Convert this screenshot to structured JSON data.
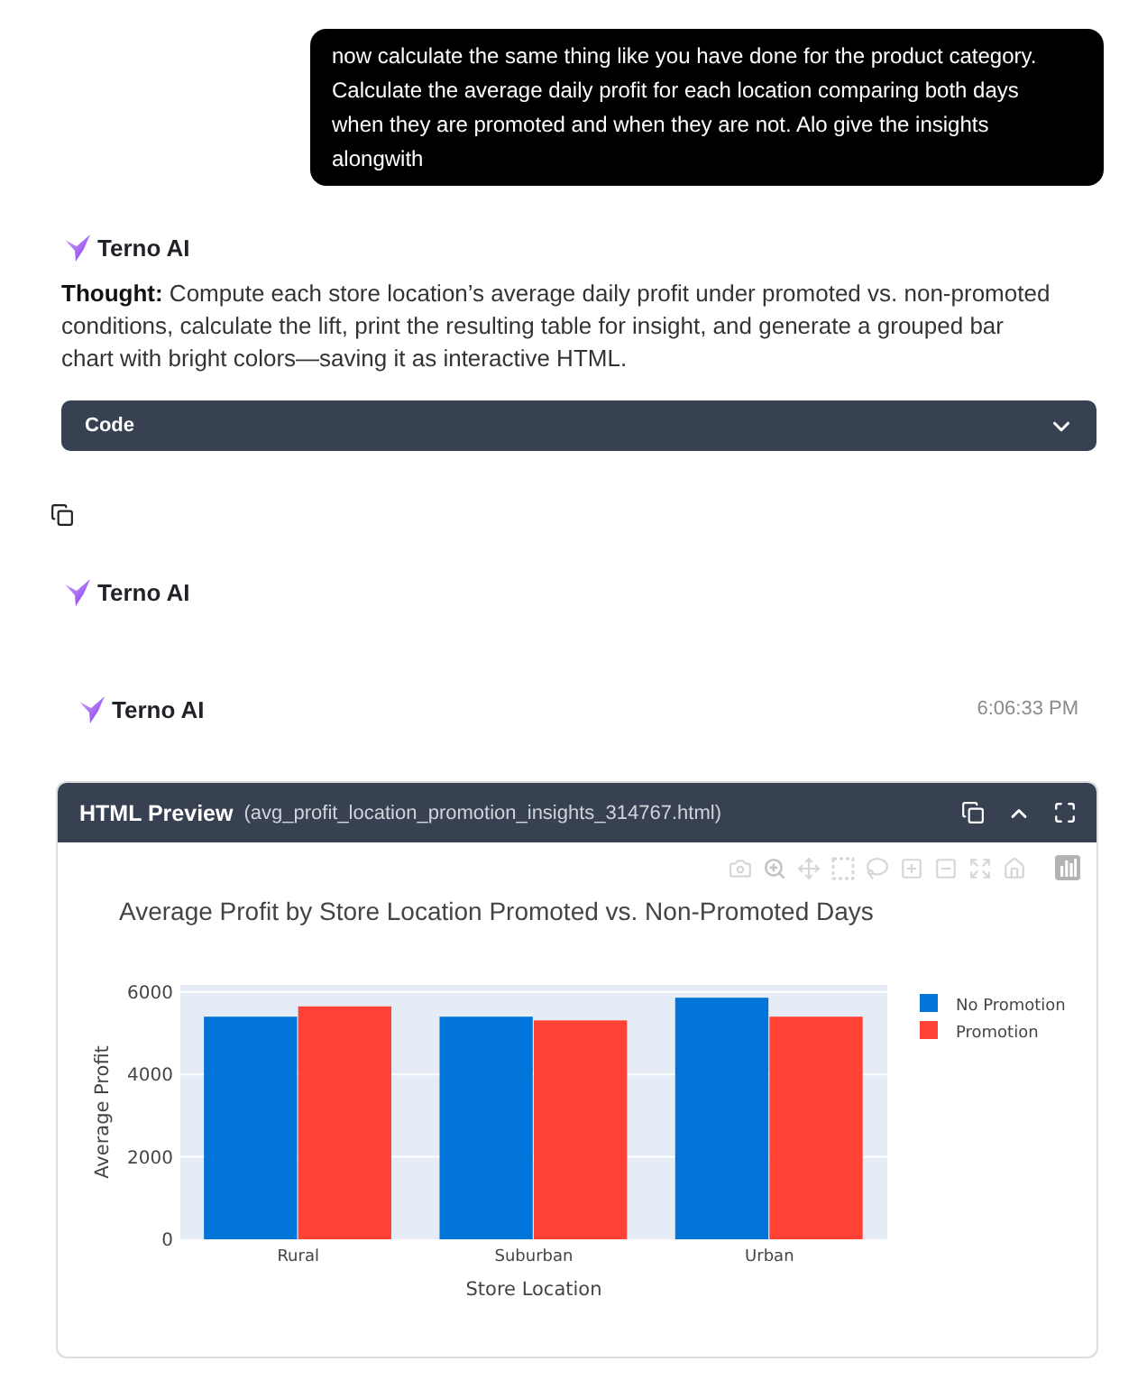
{
  "user_message": {
    "text": "now calculate the same thing like you have done for the product category. Calculate the average daily profit for each location comparing both days when they are promoted and when they are not. Alo give the insights alongwith"
  },
  "reply": {
    "author": "Terno AI",
    "thought": "**Thought:** Compute each store location’s average daily profit under promoted vs. non-promoted conditions, calculate the lift, print the resulting table for insight, and generate a grouped bar chart with bright colors—saving it as interactive HTML.",
    "code_section": {
      "label": "Code",
      "expanded": false
    }
  },
  "reply_2": {
    "author": "Terno AI"
  },
  "reply_3": {
    "author": "Terno AI",
    "time": "6:06:33 PM",
    "html_preview": {
      "title": "HTML Preview",
      "filename": "(avg_profit_location_promotion_insights_314767.html)",
      "expanded": true,
      "chart_data": {
        "type": "bar",
        "title": "Average Profit by Store Location Promoted vs. Non-Promoted Days",
        "xlabel": "Store Location",
        "ylabel": "Average Profit",
        "categories": [
          "Rural",
          "Suburban",
          "Urban"
        ],
        "series": [
          {
            "name": "No Promotion",
            "color": "#0074d9",
            "values": [
              5400,
              5400,
              5860
            ]
          },
          {
            "name": "Promotion",
            "color": "#ff4136",
            "values": [
              5650,
              5310,
              5400
            ]
          }
        ],
        "ylim": [
          0,
          6170
        ],
        "yticks": [
          0,
          2000,
          4000,
          6000
        ],
        "grid": true,
        "legend": "right"
      }
    }
  }
}
